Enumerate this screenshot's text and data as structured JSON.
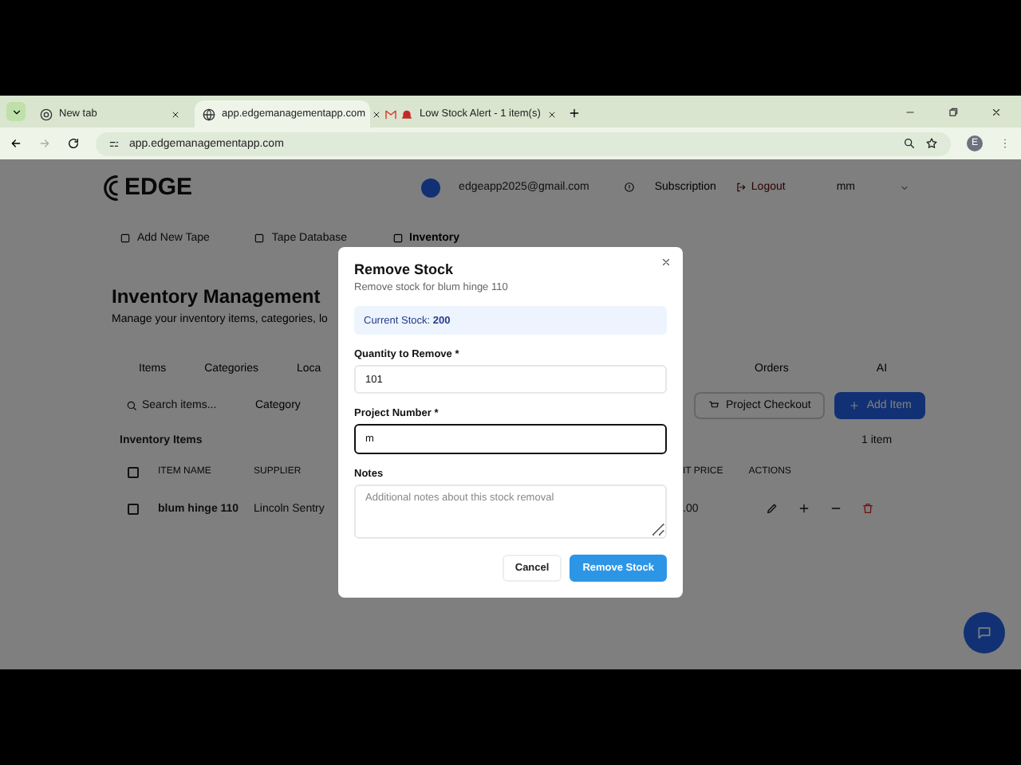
{
  "browser": {
    "tabs": [
      {
        "title": "New tab",
        "selected": false,
        "kind": "chrome"
      },
      {
        "title": "app.edgemanagementapp.com",
        "selected": true,
        "kind": "globe"
      },
      {
        "title": "Low Stock Alert - 1 item(s)",
        "selected": false,
        "kind": "mail"
      }
    ],
    "url": "app.edgemanagementapp.com",
    "forward_disabled": true,
    "profile_initial": "E"
  },
  "header": {
    "brand": "EDGE",
    "email": "edgeapp2025@gmail.com",
    "subscription": "Subscription",
    "logout": "Logout",
    "user": "mm"
  },
  "nav": [
    {
      "label": "Add New Tape",
      "selected": false
    },
    {
      "label": "Tape Database",
      "selected": false
    },
    {
      "label": "Inventory",
      "selected": true
    }
  ],
  "page": {
    "title": "Inventory Management",
    "subtitle": "Manage your inventory items, categories, lo"
  },
  "section_tabs": {
    "left": [
      "Items",
      "Categories",
      "Loca"
    ],
    "right": [
      "Orders",
      "AI"
    ]
  },
  "toolbar": {
    "search_placeholder": "Search items...",
    "category": "Category",
    "checkout": "Project Checkout",
    "add": "Add Item"
  },
  "table": {
    "title": "Inventory Items",
    "count": "1 item",
    "select_all_checked": false,
    "columns_left": [
      "ITEM NAME",
      "SUPPLIER"
    ],
    "columns_right": [
      "IT PRICE",
      "ACTIONS"
    ],
    "rows": [
      {
        "name": "blum hinge 110",
        "supplier": "Lincoln Sentry",
        "price": ".00",
        "checked": false
      }
    ]
  },
  "dialog": {
    "title": "Remove Stock",
    "subtitle": "Remove stock for blum hinge 110",
    "info": "Current Stock: **200**",
    "fields": [
      {
        "kind": "input",
        "label": "Quantity to Remove *",
        "value": "101",
        "focused": false
      },
      {
        "kind": "input",
        "label": "Project Number *",
        "value": "m",
        "focused": true
      },
      {
        "kind": "textarea",
        "label": "Notes",
        "placeholder": "Additional notes about this stock removal"
      }
    ],
    "buttons": [
      {
        "label": "Cancel",
        "kind": "secondary"
      },
      {
        "label": "Remove Stock",
        "kind": "primary"
      }
    ]
  }
}
